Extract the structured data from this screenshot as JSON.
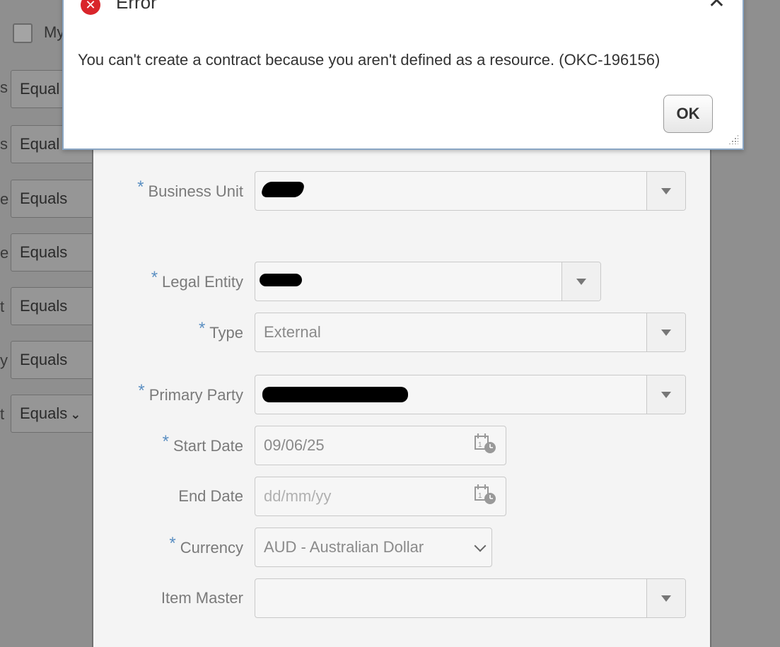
{
  "background": {
    "checkbox_label": "My",
    "rows": [
      {
        "letter": "s",
        "operator": "Equal"
      },
      {
        "letter": "s",
        "operator": "Equal"
      },
      {
        "letter": "e",
        "operator": "Equals"
      },
      {
        "letter": "e",
        "operator": "Equals"
      },
      {
        "letter": "t",
        "operator": "Equals"
      },
      {
        "letter": "y",
        "operator": "Equals"
      },
      {
        "letter": "t",
        "operator": "Equals"
      }
    ]
  },
  "form": {
    "required_marker": "*",
    "business_unit": {
      "label": "Business Unit",
      "required": true
    },
    "legal_entity": {
      "label": "Legal Entity",
      "required": true
    },
    "type": {
      "label": "Type",
      "value": "External",
      "required": true
    },
    "primary_party": {
      "label": "Primary Party",
      "required": true
    },
    "start_date": {
      "label": "Start Date",
      "value": "09/06/25",
      "required": true
    },
    "end_date": {
      "label": "End Date",
      "placeholder": "dd/mm/yy",
      "required": false
    },
    "currency": {
      "label": "Currency",
      "value": "AUD - Australian Dollar",
      "required": true
    },
    "item_master": {
      "label": "Item Master",
      "required": false
    }
  },
  "error_dialog": {
    "title": "Error",
    "close_symbol": "✕",
    "message": "You can't create a contract because you aren't defined as a resource. (OKC-196156)",
    "ok_label": "OK"
  },
  "colors": {
    "overlay": "#8f8f8f",
    "required_marker": "#5b8fc2",
    "error_icon": "#d9252b"
  }
}
